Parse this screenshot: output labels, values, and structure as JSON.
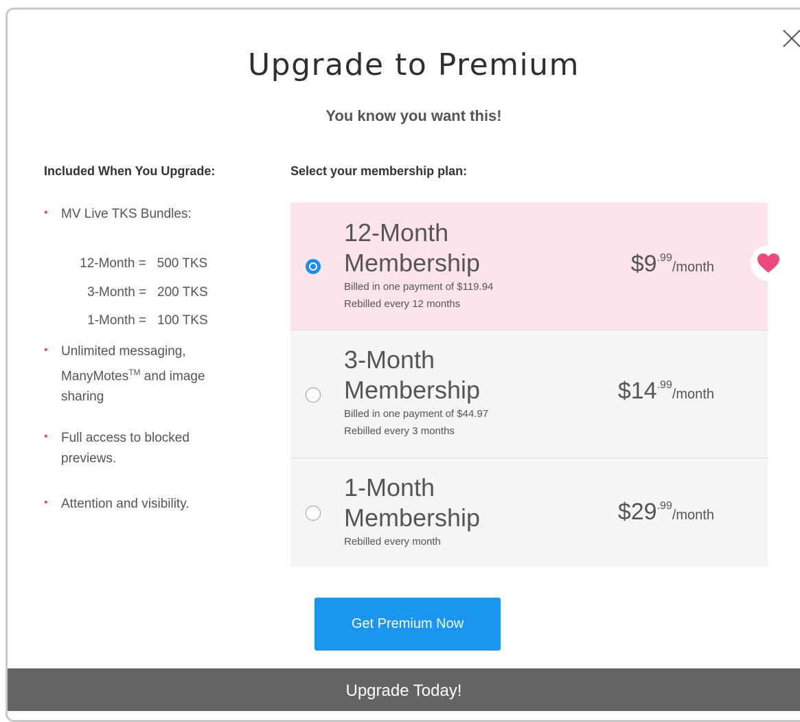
{
  "modal": {
    "title": "Upgrade to Premium",
    "subtitle": "You know you want this!",
    "close_icon": "close-icon"
  },
  "benefits": {
    "heading": "Included When You Upgrade:",
    "bundles_label": "MV Live TKS Bundles:",
    "bundles": [
      {
        "term": "12-Month =",
        "tokens": "500 TKS"
      },
      {
        "term": "3-Month =",
        "tokens": "200 TKS"
      },
      {
        "term": "1-Month =",
        "tokens": "100 TKS"
      }
    ],
    "messaging_line1": "Unlimited messaging,",
    "messaging_line2_prefix": "ManyMotes",
    "messaging_line2_tm": "TM",
    "messaging_line2_suffix": " and image",
    "messaging_line3": "sharing",
    "previews": "Full access to blocked previews.",
    "attention": "Attention and visibility."
  },
  "plans": {
    "heading": "Select your membership plan:",
    "items": [
      {
        "name_line1": "12-Month",
        "name_line2": "Membership",
        "billing": "Billed in one payment of $119.94",
        "rebill": "Rebilled every 12 months",
        "price_main": "$9",
        "price_cents": ".99",
        "price_period": "/month",
        "selected": true
      },
      {
        "name_line1": "3-Month",
        "name_line2": "Membership",
        "billing": "Billed in one payment of $44.97",
        "rebill": "Rebilled every 3 months",
        "price_main": "$14",
        "price_cents": ".99",
        "price_period": "/month",
        "selected": false
      },
      {
        "name_line1": "1-Month",
        "name_line2": "Membership",
        "billing": "",
        "rebill": "Rebilled every month",
        "price_main": "$29",
        "price_cents": ".99",
        "price_period": "/month",
        "selected": false
      }
    ],
    "favorite_icon": "heart-icon"
  },
  "cta": {
    "label": "Get Premium Now"
  },
  "footer": {
    "label": "Upgrade Today!"
  },
  "colors": {
    "accent_blue": "#1a96f0",
    "selected_plan_bg": "#fde4ec",
    "heart_pink": "#ec4a7d",
    "bullet_pink": "#e94a7a",
    "footer_bg": "#646464"
  }
}
